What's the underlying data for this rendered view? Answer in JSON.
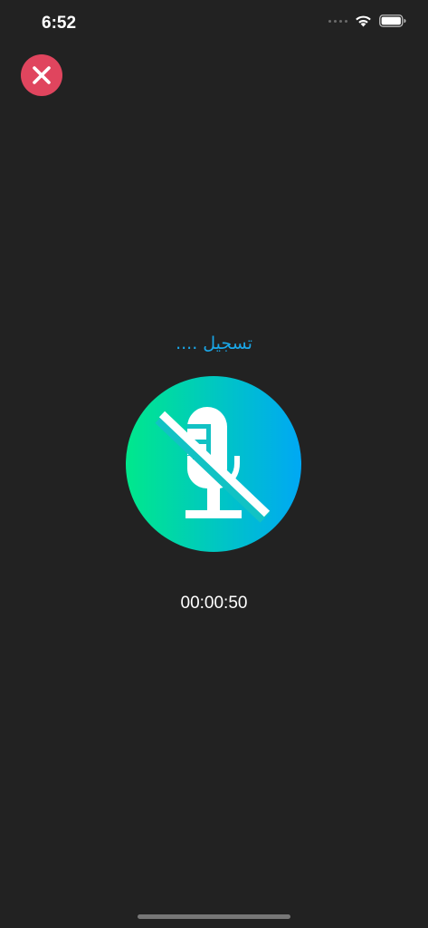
{
  "status_bar": {
    "time": "6:52"
  },
  "recording": {
    "label": "تسجيل ....",
    "timer": "00:00:50",
    "mic_state_icon": "mic-off-icon"
  },
  "colors": {
    "background": "#222222",
    "close_button": "#e0455e",
    "label": "#1aa7e8",
    "gradient_start": "#00e88c",
    "gradient_end": "#00a8f4"
  }
}
